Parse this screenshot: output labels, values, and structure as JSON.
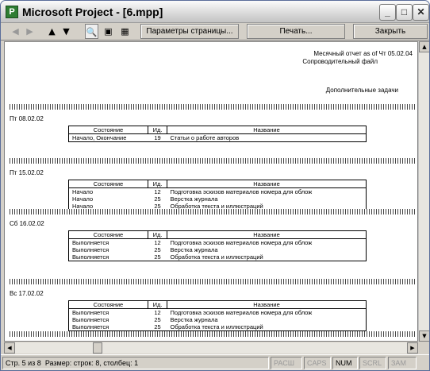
{
  "window": {
    "title": "Microsoft Project - [6.mpp]",
    "app_icon": "project-icon"
  },
  "toolbar": {
    "page_setup": "Параметры страницы...",
    "print": "Печать...",
    "close": "Закрыть"
  },
  "report": {
    "header_line1": "Месячный отчет as of Чт 05.02.04",
    "header_line2": "Сопроводительный файл",
    "subtitle": "Дополнительные задачи",
    "columns": [
      "Состояние",
      "Ид.",
      "Название"
    ],
    "groups": [
      {
        "date": "Пт 08.02.02",
        "rows": [
          [
            "Начало, Окончание",
            "19",
            "Статьи о работе авторов"
          ]
        ]
      },
      {
        "date": "Пт 15.02.02",
        "rows": [
          [
            "Начало",
            "12",
            "Подготовка эскизов материалов номера для облож"
          ],
          [
            "Начало",
            "25",
            "Верстка журнала"
          ],
          [
            "Начало",
            "25",
            "Обработка текста и иллюстраций"
          ]
        ]
      },
      {
        "date": "Сб 16.02.02",
        "rows": [
          [
            "Выполняется",
            "12",
            "Подготовка эскизов материалов номера для облож"
          ],
          [
            "Выполняется",
            "25",
            "Верстка журнала"
          ],
          [
            "Выполняется",
            "25",
            "Обработка текста и иллюстраций"
          ]
        ]
      },
      {
        "date": "Вс 17.02.02",
        "rows": [
          [
            "Выполняется",
            "12",
            "Подготовка эскизов материалов номера для облож"
          ],
          [
            "Выполняется",
            "25",
            "Верстка журнала"
          ],
          [
            "Выполняется",
            "25",
            "Обработка текста и иллюстраций"
          ]
        ]
      }
    ]
  },
  "status": {
    "page": "Стр. 5 из 8",
    "size": "Размер: строк: 8, столбец: 1",
    "ext": "РАСШ",
    "caps": "CAPS",
    "num": "NUM",
    "scrl": "SCRL",
    "ovr": "ЗАМ"
  }
}
